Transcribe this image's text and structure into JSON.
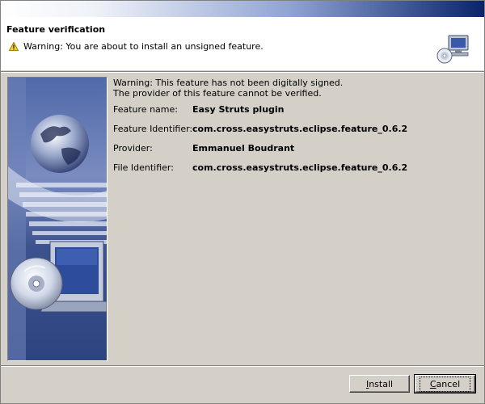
{
  "window": {
    "title": ""
  },
  "header": {
    "title": "Feature verification",
    "warning": "Warning: You are about to install an unsigned feature."
  },
  "content": {
    "warning_line1": "Warning: This feature has not been digitally signed.",
    "warning_line2": "The provider of this feature cannot be verified.",
    "fields": [
      {
        "label": "Feature name:",
        "value": "Easy Struts plugin"
      },
      {
        "label": "Feature Identifier:",
        "value": "com.cross.easystruts.eclipse.feature_0.6.2"
      },
      {
        "label": "Provider:",
        "value": "Emmanuel Boudrant"
      },
      {
        "label": "File Identifier:",
        "value": "com.cross.easystruts.eclipse.feature_0.6.2"
      }
    ]
  },
  "buttons": {
    "install_mn": "I",
    "install_rest": "nstall",
    "cancel_mn": "C",
    "cancel_rest": "ancel"
  },
  "colors": {
    "title_gradient_end": "#0a246a",
    "dialog_bg": "#d4d0c8",
    "sidebar_blue": "#3a4f8a"
  },
  "icons": [
    "warning-icon",
    "computer-cd-icon",
    "globe-icon",
    "cd-disc-icon"
  ]
}
